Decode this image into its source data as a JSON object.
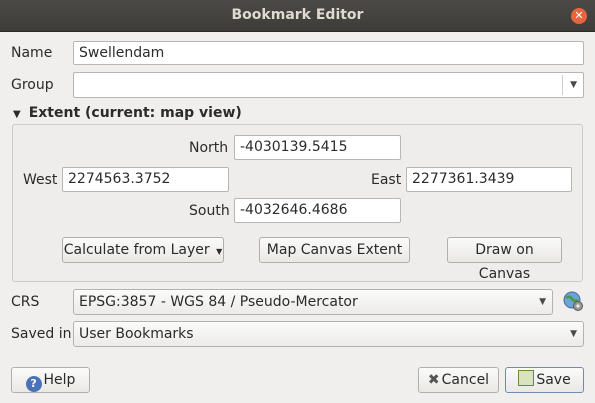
{
  "window": {
    "title": "Bookmark Editor"
  },
  "form": {
    "name_label": "Name",
    "name_value": "Swellendam",
    "group_label": "Group",
    "group_value": ""
  },
  "extent": {
    "header": "Extent (current: map view)",
    "north_label": "North",
    "north_value": "-4030139.5415",
    "west_label": "West",
    "west_value": "2274563.3752",
    "east_label": "East",
    "east_value": "2277361.3439",
    "south_label": "South",
    "south_value": "-4032646.4686",
    "calc_layer_label": "Calculate from Layer",
    "map_canvas_label": "Map Canvas Extent",
    "draw_canvas_label": "Draw on Canvas"
  },
  "crs": {
    "label": "CRS",
    "value": "EPSG:3857 - WGS 84 / Pseudo-Mercator"
  },
  "saved_in": {
    "label": "Saved in",
    "value": "User Bookmarks"
  },
  "buttons": {
    "help": "Help",
    "cancel": "Cancel",
    "save": "Save"
  }
}
